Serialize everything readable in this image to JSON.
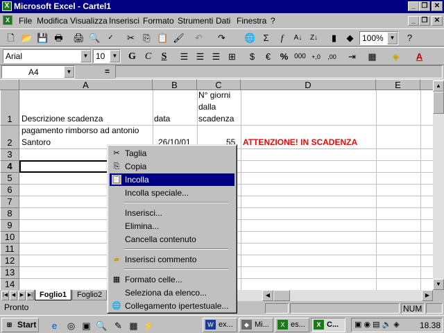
{
  "window": {
    "title": "Microsoft Excel - Cartel1"
  },
  "menu": [
    "File",
    "Modifica",
    "Visualizza",
    "Inserisci",
    "Formato",
    "Strumenti",
    "Dati",
    "Finestra",
    "?"
  ],
  "toolbar": {
    "zoom": "100%"
  },
  "format_toolbar": {
    "font": "Arial",
    "size": "10",
    "bold": "G",
    "italic": "C",
    "underline": "S"
  },
  "formula_bar": {
    "name_box": "A4",
    "equals": "="
  },
  "columns": [
    "A",
    "B",
    "C",
    "D",
    "E"
  ],
  "rows": [
    "1",
    "2",
    "3",
    "4",
    "5",
    "6",
    "7",
    "8",
    "9",
    "10",
    "11",
    "12",
    "13",
    "14"
  ],
  "cells": {
    "A1": "Descrizione scadenza",
    "B1": "data",
    "C1": "N° giorni dalla scadenza",
    "A2_line1": "pagamento rimborso ad antonio",
    "A2_line2": "Santoro",
    "B2": "26/10/01",
    "C2": "55",
    "D2": "ATTENZIONE! IN SCADENZA"
  },
  "context_menu": {
    "items": [
      {
        "label": "Taglia",
        "icon": "scissors-icon"
      },
      {
        "label": "Copia",
        "icon": "copy-icon"
      },
      {
        "label": "Incolla",
        "icon": "paste-icon"
      },
      {
        "label": "Incolla speciale..."
      },
      {
        "label": "Inserisci..."
      },
      {
        "label": "Elimina..."
      },
      {
        "label": "Cancella contenuto"
      },
      {
        "label": "Inserisci commento",
        "icon": "comment-icon"
      },
      {
        "label": "Formato celle...",
        "icon": "format-cells-icon"
      },
      {
        "label": "Seleziona da elenco..."
      },
      {
        "label": "Collegamento ipertestuale...",
        "icon": "hyperlink-icon"
      }
    ],
    "selected": "Incolla"
  },
  "sheet_tabs": [
    "Foglio1",
    "Foglio2"
  ],
  "status": {
    "text": "Pronto",
    "num": "NUM"
  },
  "taskbar": {
    "start": "Start",
    "buttons": [
      "ex...",
      "Mi...",
      "es...",
      "C..."
    ],
    "clock": "18.38"
  },
  "colors": {
    "title_bar": "#000080",
    "alert_text": "#ff0000",
    "face": "#c0c0c0"
  }
}
